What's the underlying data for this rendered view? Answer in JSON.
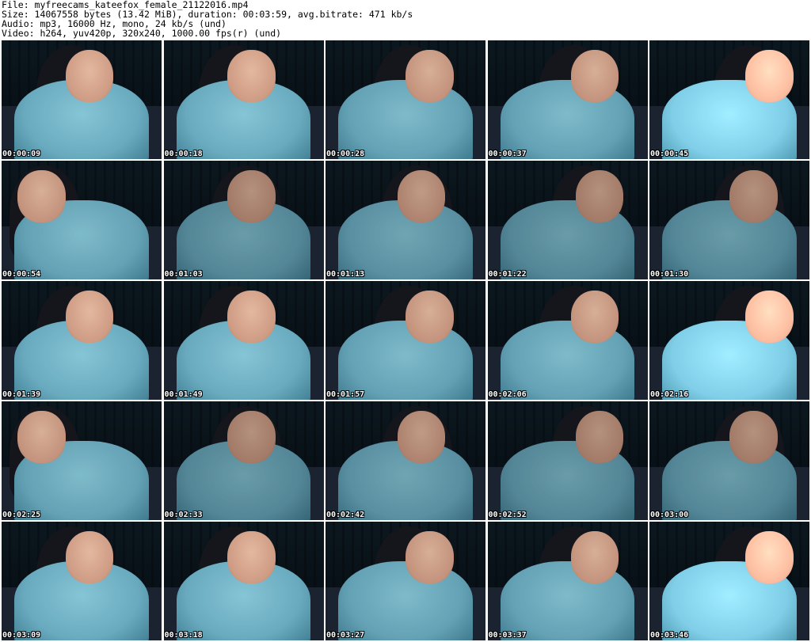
{
  "header": {
    "file_line": "File: myfreecams_kateefox_female_21122016.mp4",
    "size_line": "Size: 14067558 bytes (13.42 MiB), duration: 00:03:59, avg.bitrate: 471 kb/s",
    "audio_line": "Audio: mp3, 16000 Hz, mono, 24 kb/s (und)",
    "video_line": "Video: h264, yuv420p, 320x240, 1000.00 fps(r) (und)"
  },
  "thumbnails": [
    {
      "timestamp": "00:00:09"
    },
    {
      "timestamp": "00:00:18"
    },
    {
      "timestamp": "00:00:28"
    },
    {
      "timestamp": "00:00:37"
    },
    {
      "timestamp": "00:00:45"
    },
    {
      "timestamp": "00:00:54"
    },
    {
      "timestamp": "00:01:03"
    },
    {
      "timestamp": "00:01:13"
    },
    {
      "timestamp": "00:01:22"
    },
    {
      "timestamp": "00:01:30"
    },
    {
      "timestamp": "00:01:39"
    },
    {
      "timestamp": "00:01:49"
    },
    {
      "timestamp": "00:01:57"
    },
    {
      "timestamp": "00:02:06"
    },
    {
      "timestamp": "00:02:16"
    },
    {
      "timestamp": "00:02:25"
    },
    {
      "timestamp": "00:02:33"
    },
    {
      "timestamp": "00:02:42"
    },
    {
      "timestamp": "00:02:52"
    },
    {
      "timestamp": "00:03:00"
    },
    {
      "timestamp": "00:03:09"
    },
    {
      "timestamp": "00:03:18"
    },
    {
      "timestamp": "00:03:27"
    },
    {
      "timestamp": "00:03:37"
    },
    {
      "timestamp": "00:03:46"
    }
  ],
  "colors": {
    "background": "#ffffff",
    "text": "#000000",
    "timestamp_text": "#ffffff",
    "bookshelf": "#3a5a66",
    "sweater": "#6fb3c9",
    "skin": "#d9a38a",
    "hair": "#15161c"
  }
}
